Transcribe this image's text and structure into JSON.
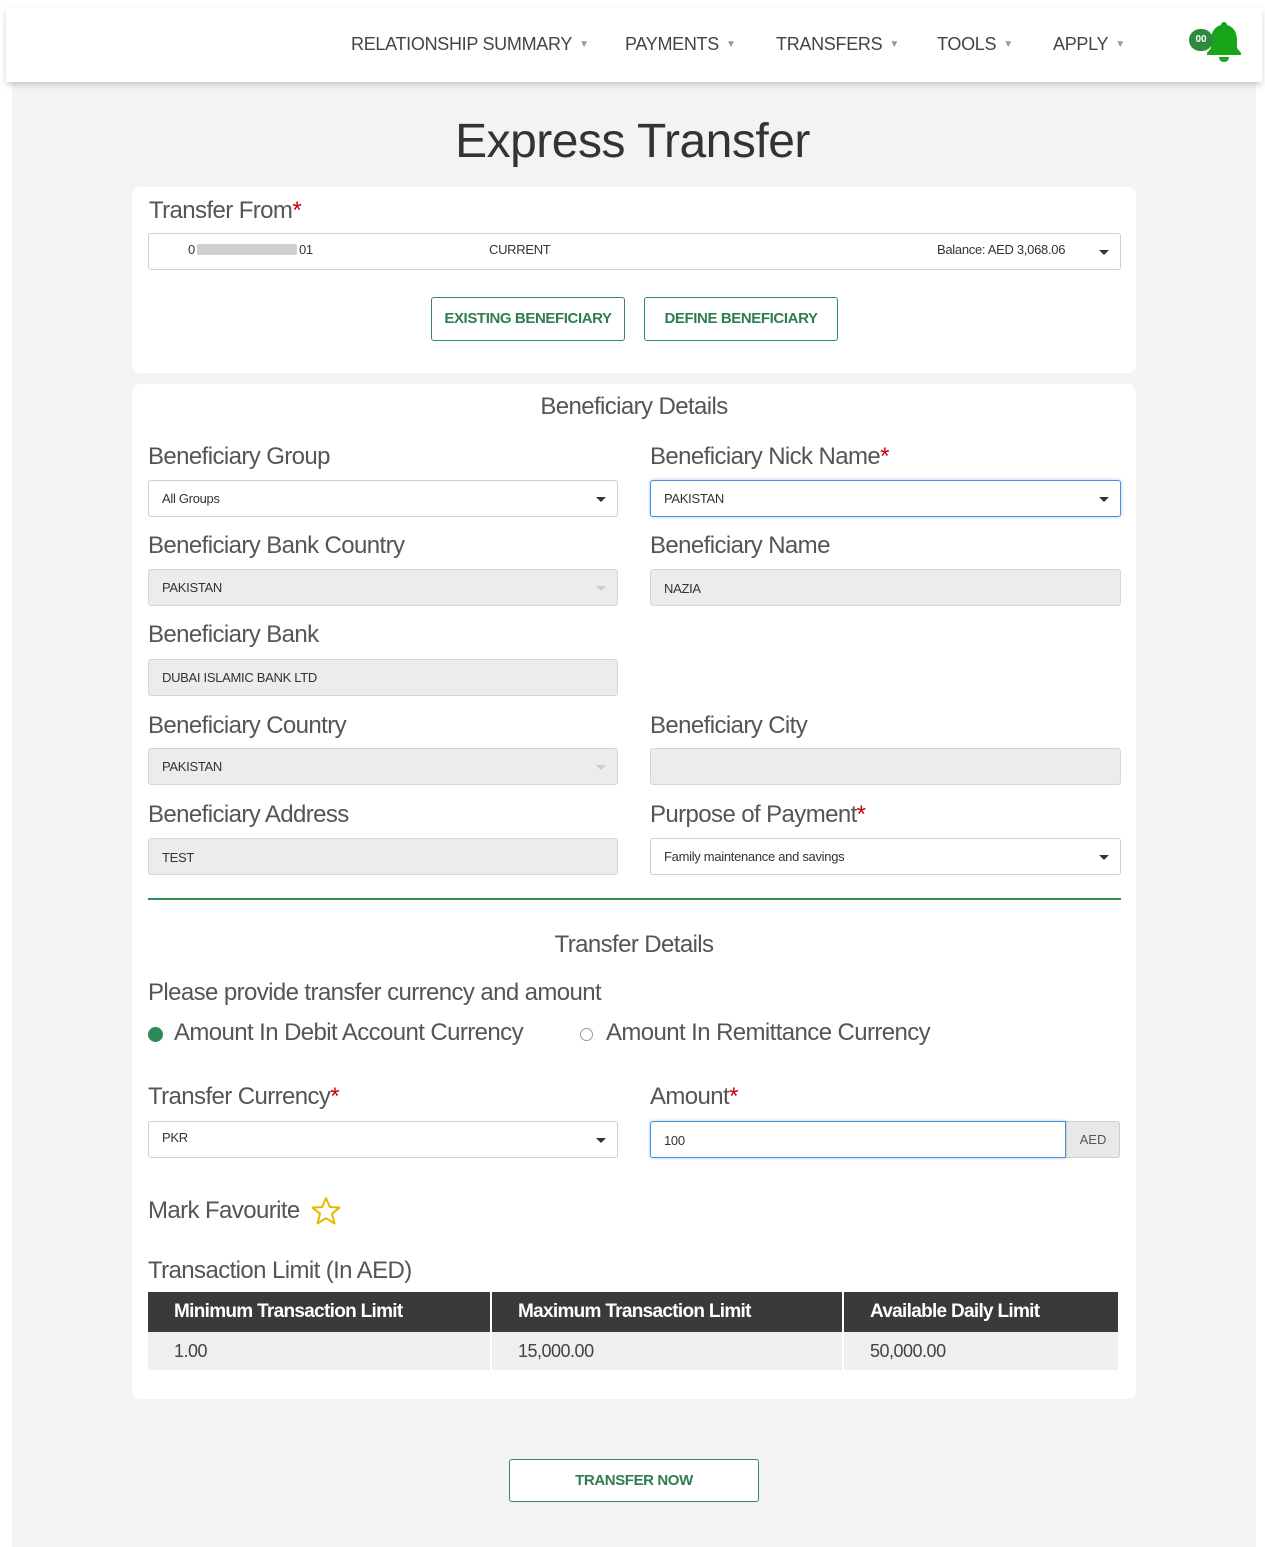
{
  "nav": {
    "items": [
      {
        "label": "RELATIONSHIP SUMMARY"
      },
      {
        "label": "PAYMENTS"
      },
      {
        "label": "TRANSFERS"
      },
      {
        "label": "TOOLS"
      },
      {
        "label": "APPLY"
      }
    ],
    "notification_badge": "00",
    "bell_icon": "bell-icon"
  },
  "page": {
    "title": "Express Transfer"
  },
  "transfer_from": {
    "label": "Transfer From",
    "account_prefix": "0",
    "account_suffix": "01",
    "account_type": "CURRENT",
    "balance": "Balance:  AED 3,068.06"
  },
  "beneficiary_buttons": {
    "existing": "EXISTING BENEFICIARY",
    "define": "DEFINE BENEFICIARY"
  },
  "beneficiary": {
    "heading": "Beneficiary Details",
    "group_label": "Beneficiary Group",
    "group_value": "All Groups",
    "nick_label": "Beneficiary Nick Name",
    "nick_value": "PAKISTAN",
    "bank_country_label": "Beneficiary Bank Country",
    "bank_country_value": "PAKISTAN",
    "name_label": "Beneficiary Name",
    "name_value": "NAZIA",
    "bank_label": "Beneficiary Bank",
    "bank_value": "DUBAI ISLAMIC BANK LTD",
    "country_label": "Beneficiary Country",
    "country_value": "PAKISTAN",
    "city_label": "Beneficiary City",
    "city_value": "",
    "address_label": "Beneficiary Address",
    "address_value": "TEST",
    "purpose_label": "Purpose of Payment",
    "purpose_value": "Family maintenance and savings"
  },
  "transfer": {
    "heading": "Transfer Details",
    "prompt": "Please provide transfer currency and amount",
    "radio_debit": "Amount In Debit Account Currency",
    "radio_remit": "Amount In Remittance Currency",
    "currency_label": "Transfer Currency",
    "currency_value": "PKR",
    "amount_label": "Amount",
    "amount_value": "100",
    "amount_addon": "AED",
    "favourite_label": "Mark Favourite"
  },
  "limits": {
    "title": "Transaction Limit (In AED)",
    "headers": [
      "Minimum Transaction Limit",
      "Maximum Transaction Limit",
      "Available Daily Limit"
    ],
    "values": [
      "1.00",
      "15,000.00",
      "50,000.00"
    ]
  },
  "submit": {
    "label": "TRANSFER NOW"
  },
  "required_mark": "*",
  "colors": {
    "brand_green": "#2e8b57",
    "required": "#cc0000",
    "table_header": "#3a3a3a"
  }
}
